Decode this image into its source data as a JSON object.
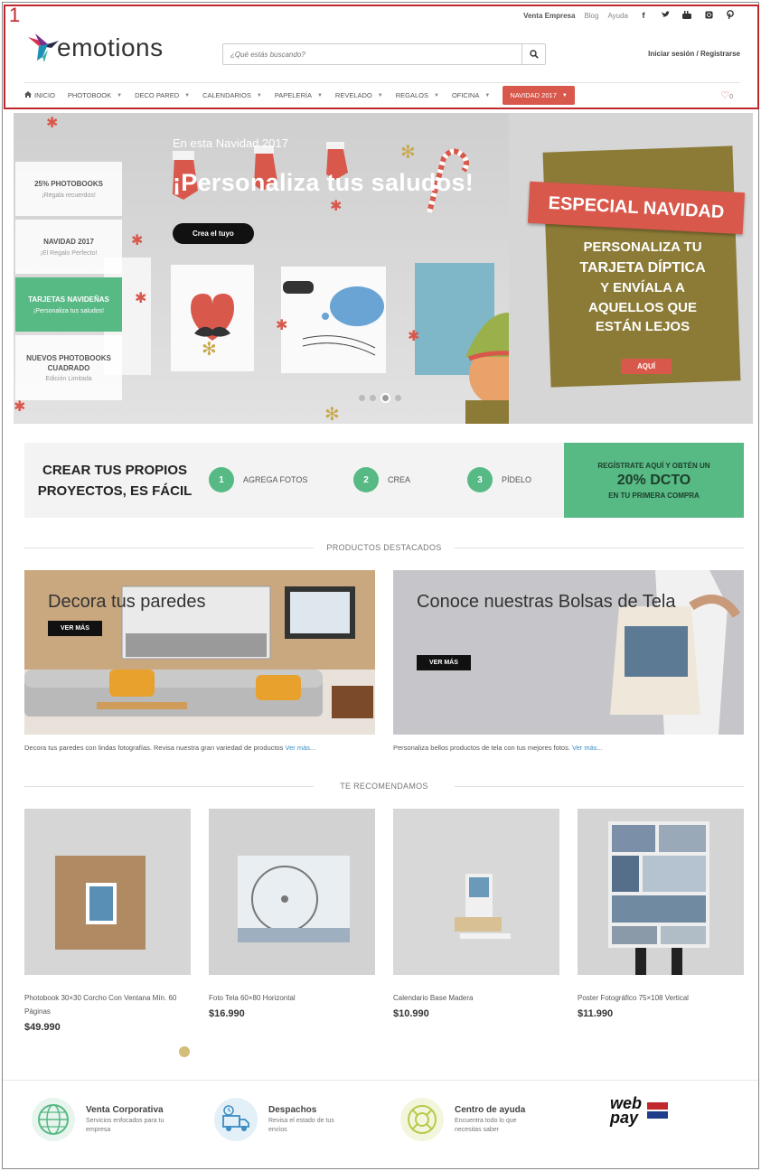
{
  "annotation": {
    "number": "1"
  },
  "util_bar": {
    "venta_empresa": "Venta Empresa",
    "blog": "Blog",
    "ayuda": "Ayuda",
    "social": [
      "f",
      "t",
      "yt",
      "ig",
      "p"
    ]
  },
  "header": {
    "logo_text": "emotions",
    "search_placeholder": "¿Qué estás buscando?",
    "login": "Iniciar sesión / Registrarse"
  },
  "nav": {
    "items": [
      "INICIO",
      "PHOTOBOOK",
      "DECO PARED",
      "CALENDARIOS",
      "PAPELERÍA",
      "REVELADO",
      "REGALOS",
      "OFICINA"
    ],
    "highlight": "NAVIDAD 2017",
    "wishlist_count": "0",
    "accent_color": "#d9584c"
  },
  "hero": {
    "subtitle": "En esta Navidad 2017",
    "title": "¡Personaliza tus saludos!",
    "button": "Crea el tuyo",
    "side_menu": [
      {
        "title": "25% PHOTOBOOKS",
        "subtitle": "¡Regala recuerdos!"
      },
      {
        "title": "NAVIDAD 2017",
        "subtitle": "¡El Regalo Perfecto!"
      },
      {
        "title": "TARJETAS NAVIDEÑAS",
        "subtitle": "¡Personaliza tus saludos!"
      },
      {
        "title": "NUEVOS PHOTOBOOKS CUADRADO",
        "subtitle": "Edición Limitada"
      }
    ],
    "banner_title": "ESPECIAL NAVIDAD",
    "banner_line1": "PERSONALIZA TU",
    "banner_line2": "TARJETA DÍPTICA",
    "banner_line3": "Y ENVÍALA A",
    "banner_line4": "AQUELLOS QUE",
    "banner_line5": "ESTÁN LEJOS",
    "banner_button": "AQUÍ",
    "slide_count": 4,
    "active_slide": 3
  },
  "steps": {
    "title": "CREAR TUS PROPIOS PROYECTOS, ES FÁCIL",
    "items": [
      {
        "num": "1",
        "label": "AGREGA FOTOS"
      },
      {
        "num": "2",
        "label": "CREA"
      },
      {
        "num": "3",
        "label": "PÍDELO"
      }
    ],
    "promo_line1": "REGÍSTRATE AQUÍ Y OBTÉN UN",
    "promo_line2": "20% DCTO",
    "promo_line3": "EN TU PRIMERA COMPRA",
    "accent_color": "#57b984"
  },
  "featured": {
    "section_title": "PRODUCTOS DESTACADOS",
    "cards": [
      {
        "title": "Decora tus paredes",
        "button": "VER MÁS",
        "caption": "Decora tus paredes con lindas fotografías. Revisa nuestra gran variedad de productos",
        "link": "Ver más..."
      },
      {
        "title": "Conoce nuestras Bolsas de Tela",
        "button": "VER MÁS",
        "caption": "Personaliza bellos productos de tela con tus mejores fotos.",
        "link": "Ver más..."
      }
    ]
  },
  "recommended": {
    "section_title": "TE RECOMENDAMOS",
    "products": [
      {
        "name": "Photobook 30×30 Corcho Con Ventana Mín. 60 Páginas",
        "price": "$49.990"
      },
      {
        "name": "Foto Tela 60×80 Horizontal",
        "price": "$16.990"
      },
      {
        "name": "Calendario Base Madera",
        "price": "$10.990"
      },
      {
        "name": "Poster Fotográfico 75×108 Vertical",
        "price": "$11.990"
      }
    ]
  },
  "footer": {
    "items": [
      {
        "title": "Venta Corporativa",
        "sub": "Servicios enfocados para tu empresa"
      },
      {
        "title": "Despachos",
        "sub": "Revisa el estado de tus envíos"
      },
      {
        "title": "Centro de ayuda",
        "sub": "Encuentra todo lo que necesitas saber"
      }
    ],
    "webpay_1": "web",
    "webpay_2": "pay"
  }
}
